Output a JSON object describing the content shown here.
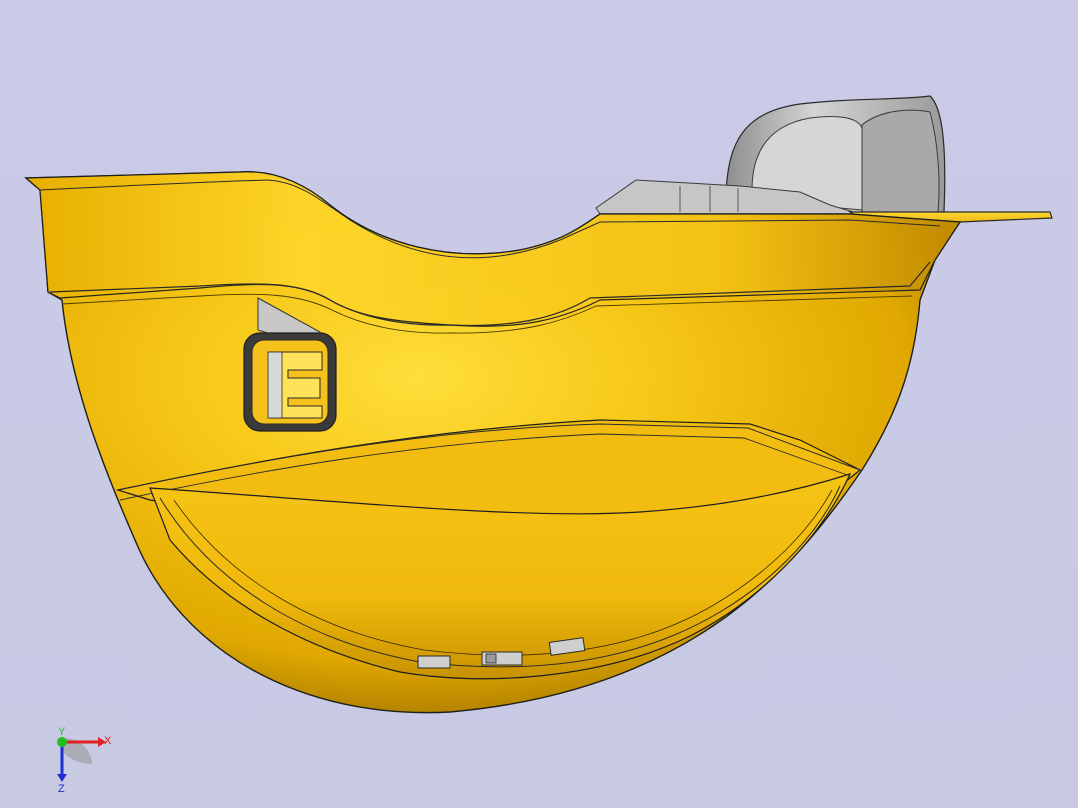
{
  "viewport": {
    "background_color": "#c9cae5",
    "part_color": "#f2bf12",
    "part_shadow_color": "#b07e00",
    "inner_part_color": "#b9b9b9",
    "edge_color": "#2a2a2a"
  },
  "triad": {
    "x_label": "X",
    "y_label": "Y",
    "z_label": "Z",
    "x_color": "#e02020",
    "y_color": "#20c020",
    "z_color": "#2030d0"
  }
}
